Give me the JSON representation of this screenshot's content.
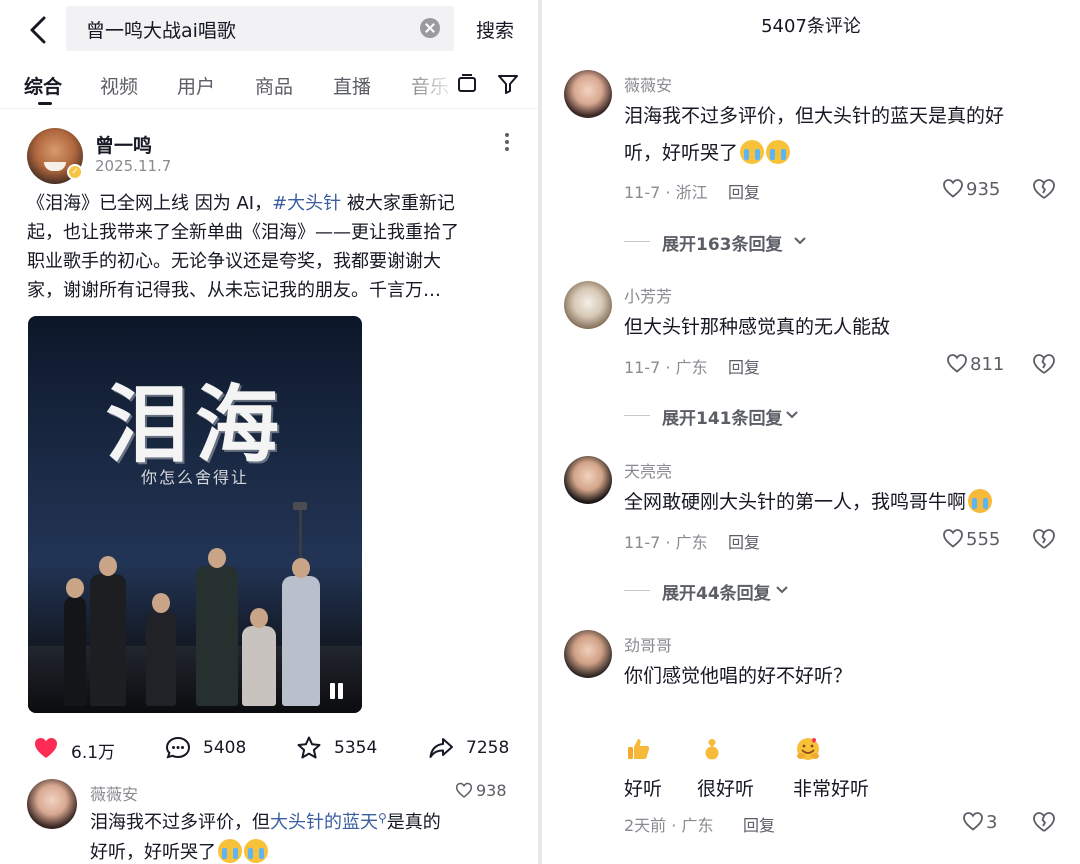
{
  "left": {
    "search": {
      "query": "曾一鸣大战ai唱歌",
      "button": "搜索"
    },
    "tabs": [
      "综合",
      "视频",
      "用户",
      "商品",
      "直播",
      "音乐"
    ],
    "post": {
      "author": "曾一鸣",
      "date": "2025.11.7",
      "caption": {
        "line1_pre": "《泪海》已全网上线 因为 AI，",
        "hashtag": "#大头针",
        "line1_post": " 被大家重新记",
        "line2": "起，也让我带来了全新单曲《泪海》——更让我重拾了",
        "line3": "职业歌手的初心。无论争议还是夸奖，我都要谢谢大",
        "line4": "家，谢谢所有记得我、从未忘记我的朋友。千言万…"
      },
      "video": {
        "title": "泪海",
        "subtitle": "你怎么舍得让"
      },
      "actions": {
        "likes": "6.1万",
        "comments": "5408",
        "favorites": "5354",
        "shares": "7258"
      }
    },
    "preview_comment": {
      "user": "薇薇安",
      "likes": "938",
      "text_pre": "泪海我不过多评价，但",
      "link": "大头针的蓝天",
      "text_post1": "是真的",
      "text_line2": "好听，好听哭了"
    }
  },
  "right": {
    "comment_count": "5407条评论",
    "comments": [
      {
        "user": "薇薇安",
        "line1": "泪海我不过多评价，但大头针的蓝天是真的好",
        "line2": "听，好听哭了",
        "meta": "11-7 · 浙江",
        "reply": "回复",
        "likes": "935",
        "expand": "展开163条回复"
      },
      {
        "user": "小芳芳",
        "line1": "但大头针那种感觉真的无人能敌",
        "meta": "11-7 · 广东",
        "reply": "回复",
        "likes": "811",
        "expand": "展开141条回复"
      },
      {
        "user": "天亮亮",
        "line1": "全网敢硬刚大头针的第一人，我鸣哥牛啊",
        "meta": "11-7 · 广东",
        "reply": "回复",
        "likes": "555",
        "expand": "展开44条回复"
      },
      {
        "user": "劲哥哥",
        "line1": "你们感觉他唱的好不好听？",
        "meta": "2天前 · 广东",
        "reply": "回复",
        "likes": "3"
      }
    ],
    "reactions": [
      {
        "icon": "thumbs-up-emoji",
        "label": "好听"
      },
      {
        "icon": "finger-heart-emoji",
        "label": "很好听"
      },
      {
        "icon": "hugging-emoji",
        "label": "非常好听"
      }
    ]
  },
  "colors": {
    "like_red": "#fe2c55",
    "hashtag_blue": "#3b5ea0",
    "meta_gray": "#8a8b91"
  }
}
